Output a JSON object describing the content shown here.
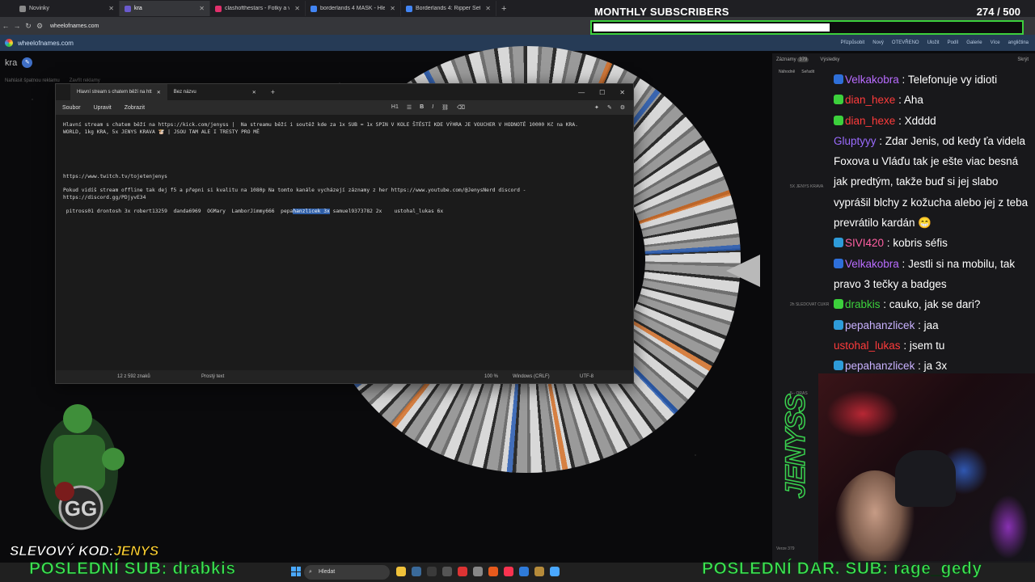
{
  "browser": {
    "tabs": [
      {
        "label": "Novinky",
        "active": false,
        "color": "#8a8a8a"
      },
      {
        "label": "kra",
        "active": true,
        "color": "#6a5acd"
      },
      {
        "label": "clashofthestars - Fotky a videa",
        "active": false,
        "color": "#e1306c"
      },
      {
        "label": "borderlands 4 MASK - Hledat G",
        "active": false,
        "color": "#4285f4"
      },
      {
        "label": "Borderlands 4: Ripper Set - Xbo",
        "active": false,
        "color": "#4285f4"
      }
    ],
    "new_tab": "+",
    "url": "wheelofnames.com"
  },
  "site": {
    "header_title": "wheelofnames.com",
    "menu": [
      "Přizpůsobit",
      "Nový",
      "OTEVŘENO",
      "Uložit",
      "Podíl",
      "Galerie",
      "Více",
      "angličtina"
    ],
    "wheel_title": "kra",
    "ad_links": [
      "Nahlásit špatnou reklamu",
      "Zavřít reklamy"
    ],
    "right_tabs": [
      "Záznamy",
      "Výsledky",
      "Skrýt"
    ],
    "entries_count": "379",
    "sort_labels": [
      "Náhodně",
      "Seřadit"
    ],
    "side_entries": [
      "5X JENYS KRAVA",
      "2h SLEDOVAT CUKR",
      "5-- ORAS"
    ],
    "version": "Verze 379"
  },
  "notepad": {
    "tabs": [
      "Hlavní stream s chatem běží na htt",
      "Bez názvu"
    ],
    "menu": [
      "Soubor",
      "Upravit",
      "Zobrazit"
    ],
    "heading": "H1",
    "line1": "Hlavní stream s chatem běží na https://kick.com/jenyss |  Na streamu běží i soutěž kde za 1x SUB = 1x SPIN V KOLE ŠTĚSTÍ KDE VÝHRA JE VOUCHER V HODNOTĚ 10000 Kč na KRA.",
    "line2": "WORLD, 1kg KRA, 5x JENYS KRAVA 🐮 | JSOU TAM ALE I TRESTY PRO MĚ",
    "twitch": "https://www.twitch.tv/tojetenjenys",
    "offline1": "Pokud vidíš stream offline tak dej f5 a přepni si kvalitu na 1080p Na tomto kanále vycházejí záznamy z her https://www.youtube.com/@JenysNerd discord -",
    "offline2": "https://discord.gg/PDjyvE34",
    "names_pre": " pitross01 drontosh 3x robert13259  danda6969  OGMary  LamborJimmy666  pepa",
    "names_sel": "hanzlicek 3x",
    "names_post": " samuel9373782 2x    ustohal_lukas 6x",
    "status": {
      "pos": "12 z 592 znaků",
      "type": "Prostý text",
      "zoom": "100 %",
      "eol": "Windows (CRLF)",
      "enc": "UTF-8"
    }
  },
  "overlay": {
    "subs_title": "MONTHLY SUBSCRIBERS",
    "subs_count": "274",
    "subs_goal": "/ 500",
    "subs_progress": 0.548,
    "promo_label": "SLEVOVÝ KOD:",
    "promo_code": "JENYS",
    "ticker_left": "POSLEDNÍ SUB: drabkis",
    "ticker_right": "POSLEDNÍ DAR. SUB: rage_gedy",
    "logo_text": "JENYSS"
  },
  "chat": [
    {
      "user": "Velkakobra",
      "color": "#b96cff",
      "text": "Telefonuje vy idioti",
      "badge": "#2e6fd9"
    },
    {
      "user": "dian_hexe",
      "color": "#ff3b3b",
      "text": "Aha",
      "badge": "#3cd03c"
    },
    {
      "user": "dian_hexe",
      "color": "#ff3b3b",
      "text": "Xdddd",
      "badge": "#3cd03c"
    },
    {
      "user": "Gluptyyy",
      "color": "#9b6bff",
      "text": "Zdar Jenis, od kedy ťa videla Foxova u Vláďu tak je ešte viac besná jak predtým, takže buď si jej slabo vyprášil blchy z kožucha alebo jej z teba prevrátilo kardán 😁",
      "badge": ""
    },
    {
      "user": "SIVI420",
      "color": "#ff5fa2",
      "text": "kobris séfis",
      "badge": "#2e9bd9"
    },
    {
      "user": "Velkakobra",
      "color": "#b96cff",
      "text": "Jestli si na mobilu, tak pravo 3 tečky a badges",
      "badge": "#2e6fd9"
    },
    {
      "user": "drabkis",
      "color": "#3cd03c",
      "text": "cauko, jak se dari?",
      "badge": "#3cd03c"
    },
    {
      "user": "pepahanzlicek",
      "color": "#c9b2ff",
      "text": "jaa",
      "badge": "#2e9bd9"
    },
    {
      "user": "ustohal_lukas",
      "color": "#ff3b3b",
      "text": "jsem tu",
      "badge": ""
    },
    {
      "user": "pepahanzlicek",
      "color": "#c9b2ff",
      "text": "ja 3x",
      "badge": "#2e9bd9"
    }
  ],
  "taskbar": {
    "search_placeholder": "Hledat"
  }
}
